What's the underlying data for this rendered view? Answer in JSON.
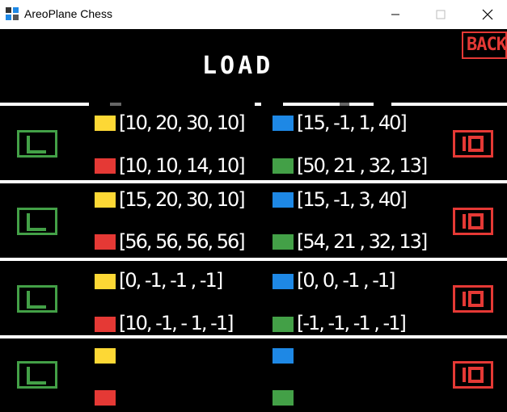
{
  "window": {
    "title": "AreoPlane Chess"
  },
  "header": {
    "back_label": "BACK",
    "title": "LOAD"
  },
  "colors": {
    "yellow": "#fdd835",
    "blue": "#1e88e5",
    "red": "#e53935",
    "green": "#43a047"
  },
  "slots": [
    {
      "yellow": "[10, 20, 30, 10]",
      "blue": "[15, -1,  1, 40]",
      "red": "[10, 10, 14, 10]",
      "green": "[50, 21 , 32, 13]"
    },
    {
      "yellow": "[15, 20, 30, 10]",
      "blue": "[15, -1,  3, 40]",
      "red": "[56, 56, 56, 56]",
      "green": "[54, 21 , 32, 13]"
    },
    {
      "yellow": "[0, -1, -1 , -1]",
      "blue": "[0, 0, -1 , -1]",
      "red": "[10, -1, - 1, -1]",
      "green": "[-1, -1, -1 , -1]"
    },
    {
      "yellow": "",
      "blue": "",
      "red": "",
      "green": ""
    }
  ]
}
